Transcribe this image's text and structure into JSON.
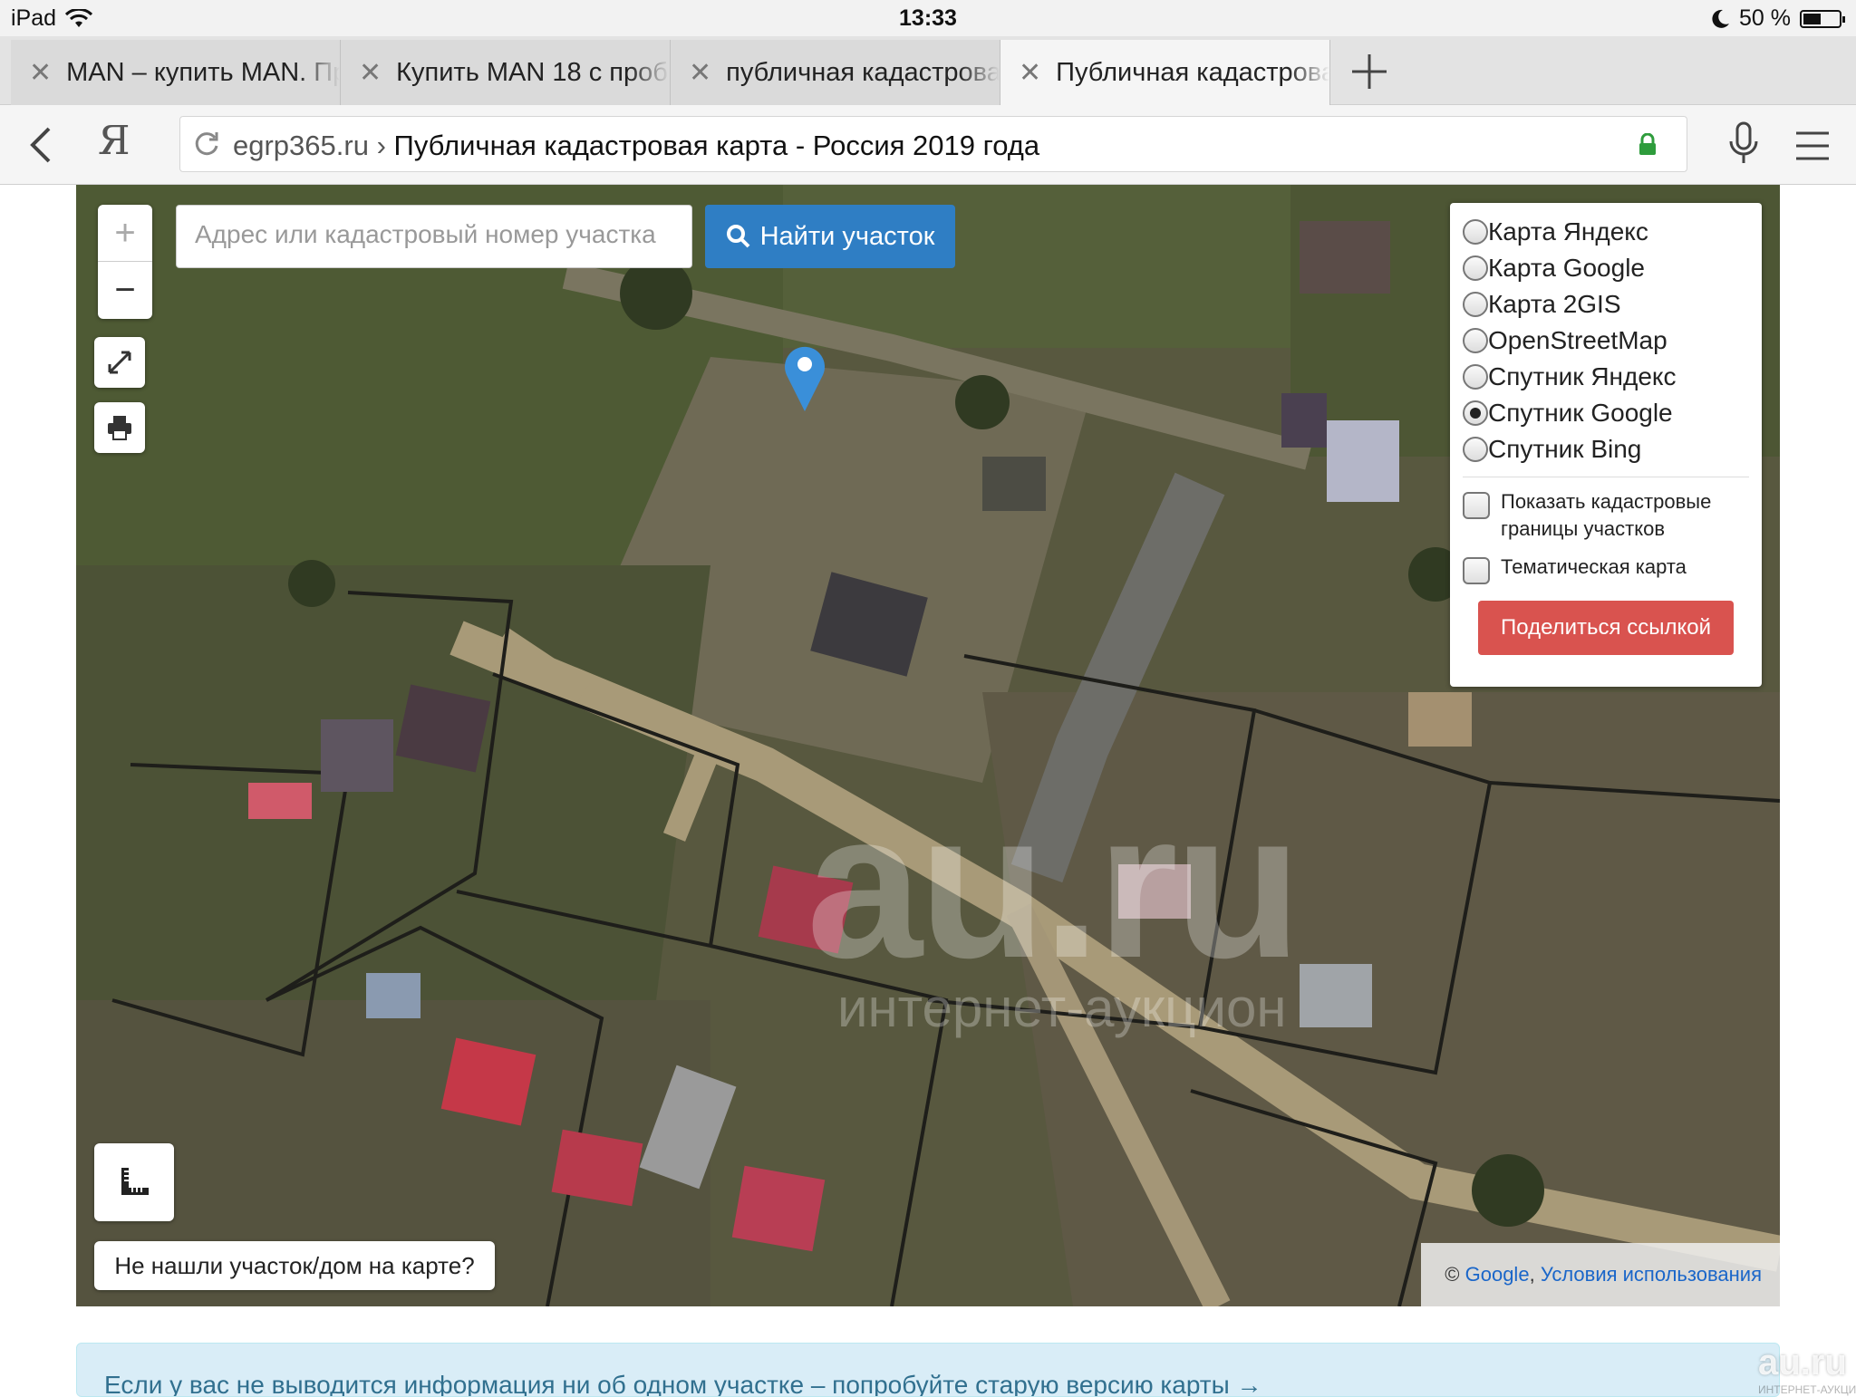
{
  "status": {
    "device": "iPad",
    "time": "13:33",
    "battery": "50 %"
  },
  "tabs": [
    {
      "label": "MAN – купить MAN. Пр",
      "active": false
    },
    {
      "label": "Купить MAN 18 с проб",
      "active": false
    },
    {
      "label": "публичная кадастрова",
      "active": false
    },
    {
      "label": "Публичная кадастрова",
      "active": true
    }
  ],
  "navbar": {
    "domain": "egrp365.ru",
    "separator": "›",
    "page_title": "Публичная кадастровая карта - Россия 2019 года",
    "brand": "Я"
  },
  "map": {
    "zoom_in": "+",
    "zoom_out": "−",
    "search_placeholder": "Адрес или кадастровый номер участка",
    "search_button": "Найти участок",
    "layers": [
      {
        "label": "Карта Яндекс",
        "selected": false
      },
      {
        "label": "Карта Google",
        "selected": false
      },
      {
        "label": "Карта 2GIS",
        "selected": false
      },
      {
        "label": "OpenStreetMap",
        "selected": false
      },
      {
        "label": "Спутник Яндекс",
        "selected": false
      },
      {
        "label": "Спутник Google",
        "selected": true
      },
      {
        "label": "Спутник Bing",
        "selected": false
      }
    ],
    "options": [
      {
        "label": "Показать кадастровые границы участков",
        "checked": false
      },
      {
        "label": "Тематическая карта",
        "checked": false
      }
    ],
    "share_button": "Поделиться ссылкой",
    "not_found": "Не нашли участок/дом на карте?",
    "attribution": {
      "copy": "©",
      "google": "Google",
      "comma": ",",
      "terms": "Условия использования"
    },
    "watermark": {
      "brand": "au.ru",
      "subtitle": "интернет-аукцион"
    }
  },
  "info_bar": "Если у вас не выводится информация ни об одном участке – попробуйте старую версию карты →",
  "corner_watermark": {
    "brand": "au.ru",
    "subtitle": "ИНТЕРНЕТ-АУКЦИОН"
  },
  "colors": {
    "accent_blue": "#2f7ec4",
    "share_red": "#d9534f",
    "pin_blue": "#3a8fd9"
  }
}
